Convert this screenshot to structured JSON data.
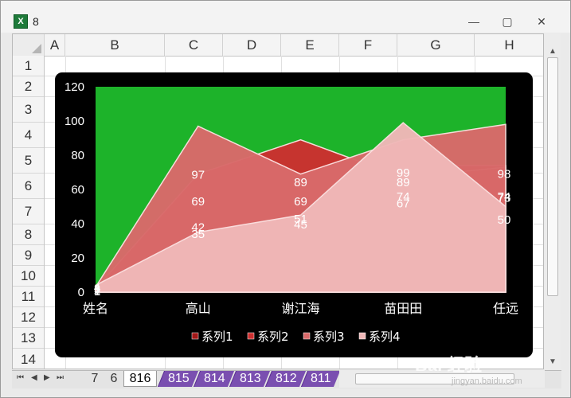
{
  "window": {
    "title": "8",
    "minimize_glyph": "—",
    "maximize_glyph": "▢",
    "close_glyph": "✕",
    "icon": "excel-icon"
  },
  "grid": {
    "columns": [
      "A",
      "B",
      "C",
      "D",
      "E",
      "F",
      "G",
      "H"
    ],
    "rows": [
      "1",
      "2",
      "3",
      "4",
      "5",
      "6",
      "7",
      "8",
      "9",
      "10",
      "11",
      "12",
      "13",
      "14"
    ]
  },
  "chart_data": {
    "type": "area",
    "categories": [
      "姓名",
      "高山",
      "谢江海",
      "苗田田",
      "任远"
    ],
    "series": [
      {
        "name": "系列1",
        "values": [
          1,
          42,
          51,
          74,
          74
        ],
        "color": "#a01818"
      },
      {
        "name": "系列2",
        "values": [
          2,
          69,
          89,
          67,
          73
        ],
        "color": "#cc3030"
      },
      {
        "name": "系列3",
        "values": [
          3,
          97,
          69,
          89,
          98
        ],
        "color": "#d96a6a"
      },
      {
        "name": "系列4",
        "values": [
          4,
          35,
          45,
          99,
          50
        ],
        "color": "#f0b8b8"
      }
    ],
    "ylim": [
      0,
      120
    ],
    "yticks": [
      0,
      20,
      40,
      60,
      80,
      100,
      120
    ],
    "plot_bg": "#1db32a",
    "chart_bg": "#000000",
    "legend": "bottom"
  },
  "sheet_tabs": {
    "nav": [
      "⏮",
      "◀",
      "▶",
      "⏭"
    ],
    "tabs": [
      "7",
      "6",
      "816",
      "815",
      "814",
      "813",
      "812",
      "811"
    ],
    "selected": "816"
  },
  "watermark": {
    "brand": "Bai 经验",
    "url": "jingyan.baidu.com"
  }
}
